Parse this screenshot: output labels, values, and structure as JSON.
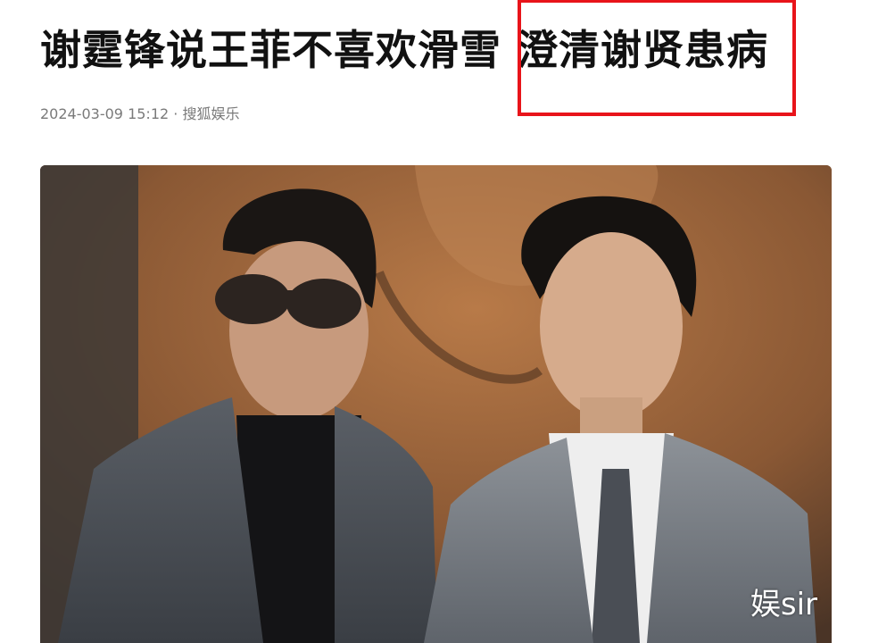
{
  "article": {
    "title": "谢霆锋说王菲不喜欢滑雪 澄清谢贤患病",
    "meta": "2024-03-09 15:12 · 搜狐娱乐"
  },
  "photo": {
    "watermark": "娱sir"
  },
  "colors": {
    "highlight_border": "#e8141a",
    "title": "#111111",
    "meta": "#7a7a7a"
  }
}
